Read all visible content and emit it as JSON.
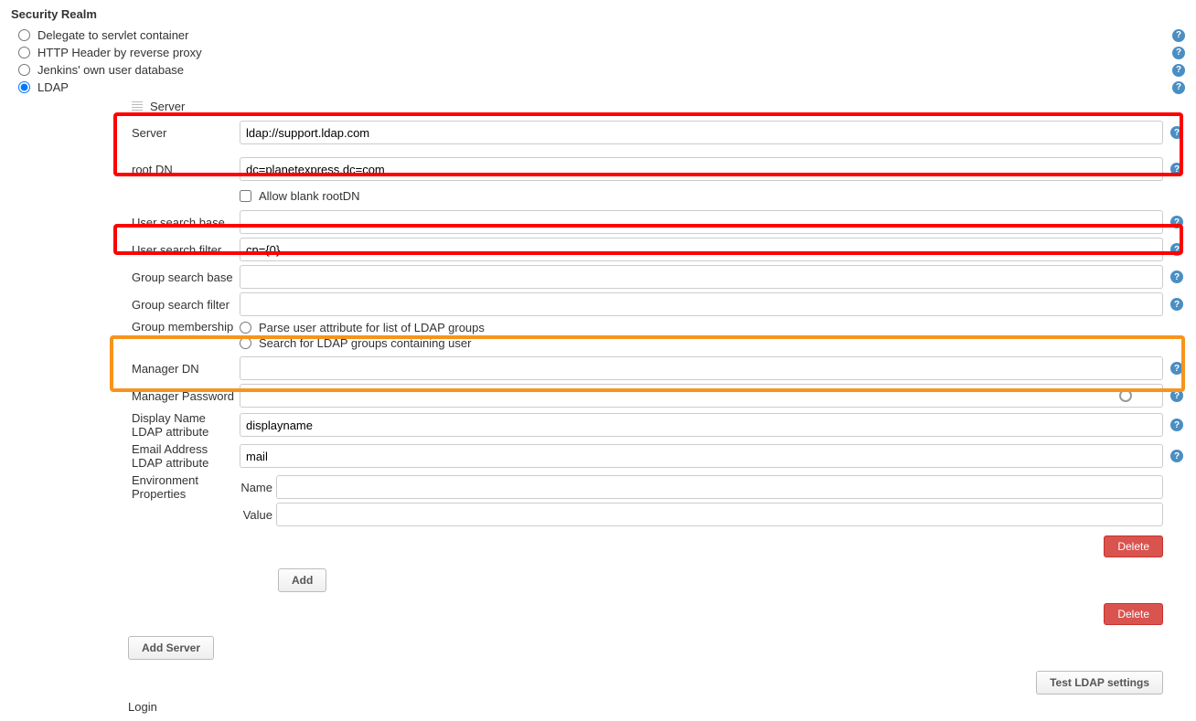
{
  "section_title": "Security Realm",
  "realms": {
    "servlet": "Delegate to servlet container",
    "http_header": "HTTP Header by reverse proxy",
    "own_db": "Jenkins' own user database",
    "ldap": "LDAP"
  },
  "ldap": {
    "server_header": "Server",
    "fields": {
      "server": {
        "label": "Server",
        "value": "ldap://support.ldap.com"
      },
      "root_dn": {
        "label": "root DN",
        "value": "dc=planetexpress,dc=com"
      },
      "allow_blank_rootdn": "Allow blank rootDN",
      "user_search_base": {
        "label": "User search base",
        "value": ""
      },
      "user_search_filter": {
        "label": "User search filter",
        "value": "cn={0}"
      },
      "group_search_base": {
        "label": "Group search base",
        "value": ""
      },
      "group_search_filter": {
        "label": "Group search filter",
        "value": ""
      },
      "group_membership": {
        "label": "Group membership",
        "opt_parse": "Parse user attribute for list of LDAP groups",
        "opt_search": "Search for LDAP groups containing user"
      },
      "manager_dn": {
        "label": "Manager DN",
        "value": ""
      },
      "manager_password": {
        "label": "Manager Password",
        "value": ""
      },
      "display_name_attr": {
        "label": "Display Name LDAP attribute",
        "value": "displayname"
      },
      "email_attr": {
        "label": "Email Address LDAP attribute",
        "value": "mail"
      },
      "env_props": {
        "label": "Environment Properties",
        "name_label": "Name",
        "value_label": "Value"
      }
    },
    "buttons": {
      "add": "Add",
      "delete": "Delete",
      "add_server": "Add Server",
      "test": "Test LDAP settings"
    },
    "login_label": "Login"
  }
}
